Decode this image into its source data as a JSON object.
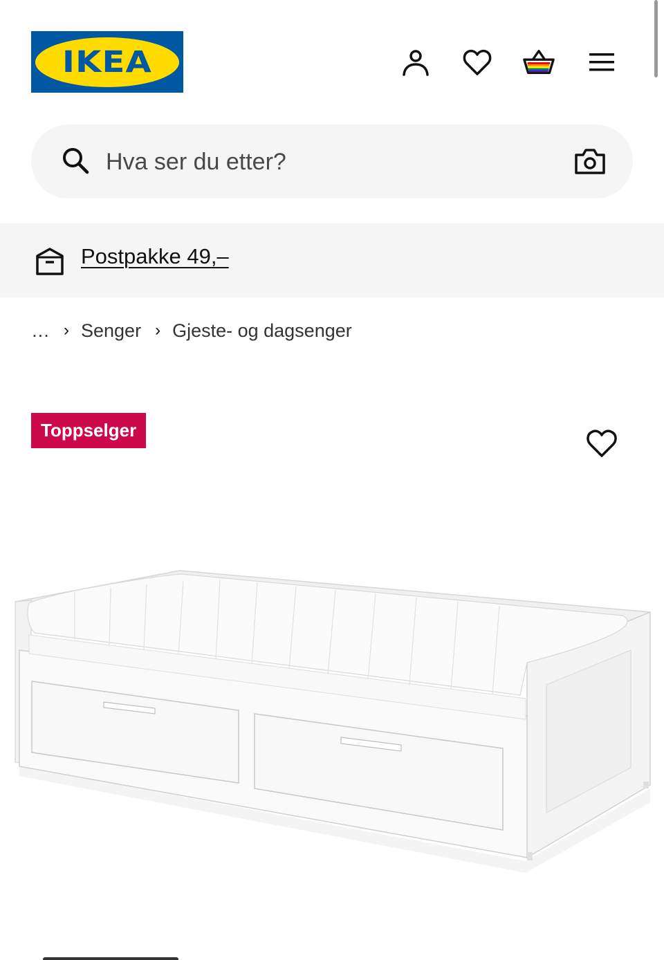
{
  "header": {
    "logo_text": "IKEA",
    "icons": [
      "user-icon",
      "heart-icon",
      "shopping-bag-icon",
      "menu-icon"
    ]
  },
  "search": {
    "placeholder": "Hva ser du etter?"
  },
  "promo": {
    "link_text": "Postpakke 49,–"
  },
  "breadcrumb": {
    "items": [
      "…",
      "Senger",
      "Gjeste- og dagsenger"
    ]
  },
  "product": {
    "badge": "Toppselger"
  },
  "colors": {
    "ikea_blue": "#0058a3",
    "ikea_yellow": "#ffdb00",
    "badge_red": "#cc0a4b",
    "search_bg": "#f5f5f5"
  }
}
